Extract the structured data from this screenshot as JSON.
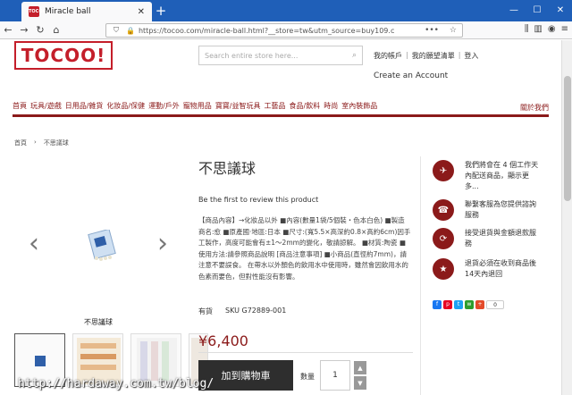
{
  "browser": {
    "tab_title": "Miracle ball",
    "favicon_text": "TOCOO",
    "url": "https://tocoo.com/miracle-ball.html?__store=tw&utm_source=buy109.c"
  },
  "header": {
    "logo": "TOCOO!",
    "search_placeholder": "Search entire store here...",
    "account_links": [
      "我的帳戶",
      "我的願望清單",
      "登入"
    ],
    "create_account": "Create an Account"
  },
  "categories": [
    "首頁",
    "玩具/遊戲",
    "日用品/雜貨",
    "化妝品/保健",
    "運動/戶外",
    "寵物用品",
    "寶寶/益智玩具",
    "工藝品",
    "食品/飲料",
    "時尚",
    "室內裝飾品"
  ],
  "category_right": "關於我們",
  "breadcrumb": [
    "首頁",
    "不思議球"
  ],
  "gallery": {
    "caption": "不思議球"
  },
  "product": {
    "title": "不思議球",
    "review_link": "Be the first to review this product",
    "description": "【商品內容】→化妝品以外 ■內容(數量1袋/5個裝・色本白色) ■製造商名:愈 ■原產國·地區:日本 ■尺寸:(寬5.5×高深約0.8×高約6cm)因手工製作，高度可能會有±1～2mm的變化，敬請諒解。 ■材質:陶瓷 ■使用方法:請參照商品說明 [商品注意事項] ■小商品(直徑約7mm)，請注意不要誤食。 在帶水以外顏色的飲用水中使用時，雖然會因飲用水的色素而要色，但對性能沒有影響。",
    "stock": "有貨",
    "sku_label": "SKU",
    "sku": "G72889-001",
    "price": "¥6,400",
    "add_to_cart": "加到購物車",
    "qty_label": "數量",
    "qty_value": "1"
  },
  "services": [
    {
      "icon": "airplane-icon",
      "text": "我們將會在 4 個工作天內配送商品，顯示更多..."
    },
    {
      "icon": "phone-icon",
      "text": "聯繫客服為您提供諮詢服務"
    },
    {
      "icon": "refresh-icon",
      "text": "接受退貨與金額退款服務"
    },
    {
      "icon": "star-icon",
      "text": "退貨必須在收到商品後14天內退回"
    }
  ],
  "share_count": "0",
  "watermark": "http://hardaway.com.tw/blog/",
  "colors": {
    "brand": "#c41e2a",
    "accent": "#8b1a1a",
    "browser": "#1f5fb8"
  }
}
